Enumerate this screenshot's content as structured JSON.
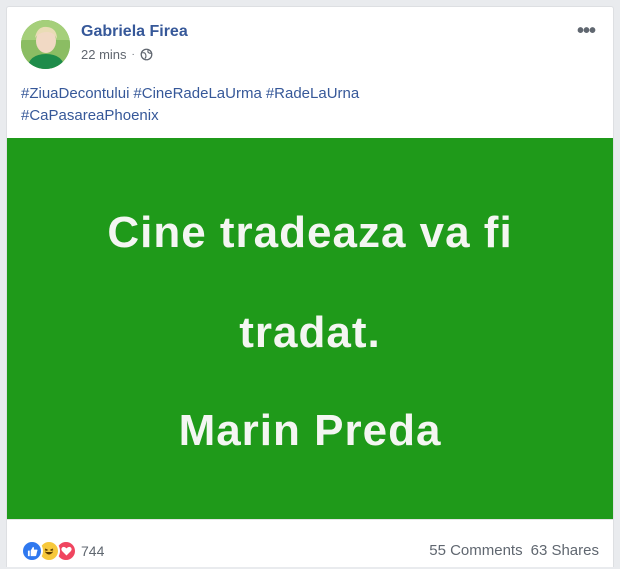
{
  "post": {
    "author": "Gabriela Firea",
    "time": "22 mins",
    "privacy_icon": "globe-icon",
    "more_icon": "more-options-icon",
    "hashtags": [
      "#ZiuaDecontului",
      "#CineRadeLaUrma",
      "#RadeLaUrna",
      "#CaPasareaPhoenix"
    ],
    "image": {
      "line1": "Cine tradeaza va fi",
      "line2": "tradat.",
      "line3": "Marin Preda",
      "background": "#1f9a1a"
    }
  },
  "footer": {
    "reaction_icons": [
      "like-icon",
      "haha-icon",
      "love-icon"
    ],
    "reaction_count": "744",
    "comments": "55 Comments",
    "shares": "63 Shares"
  },
  "colors": {
    "link": "#365899",
    "meta": "#616770"
  }
}
